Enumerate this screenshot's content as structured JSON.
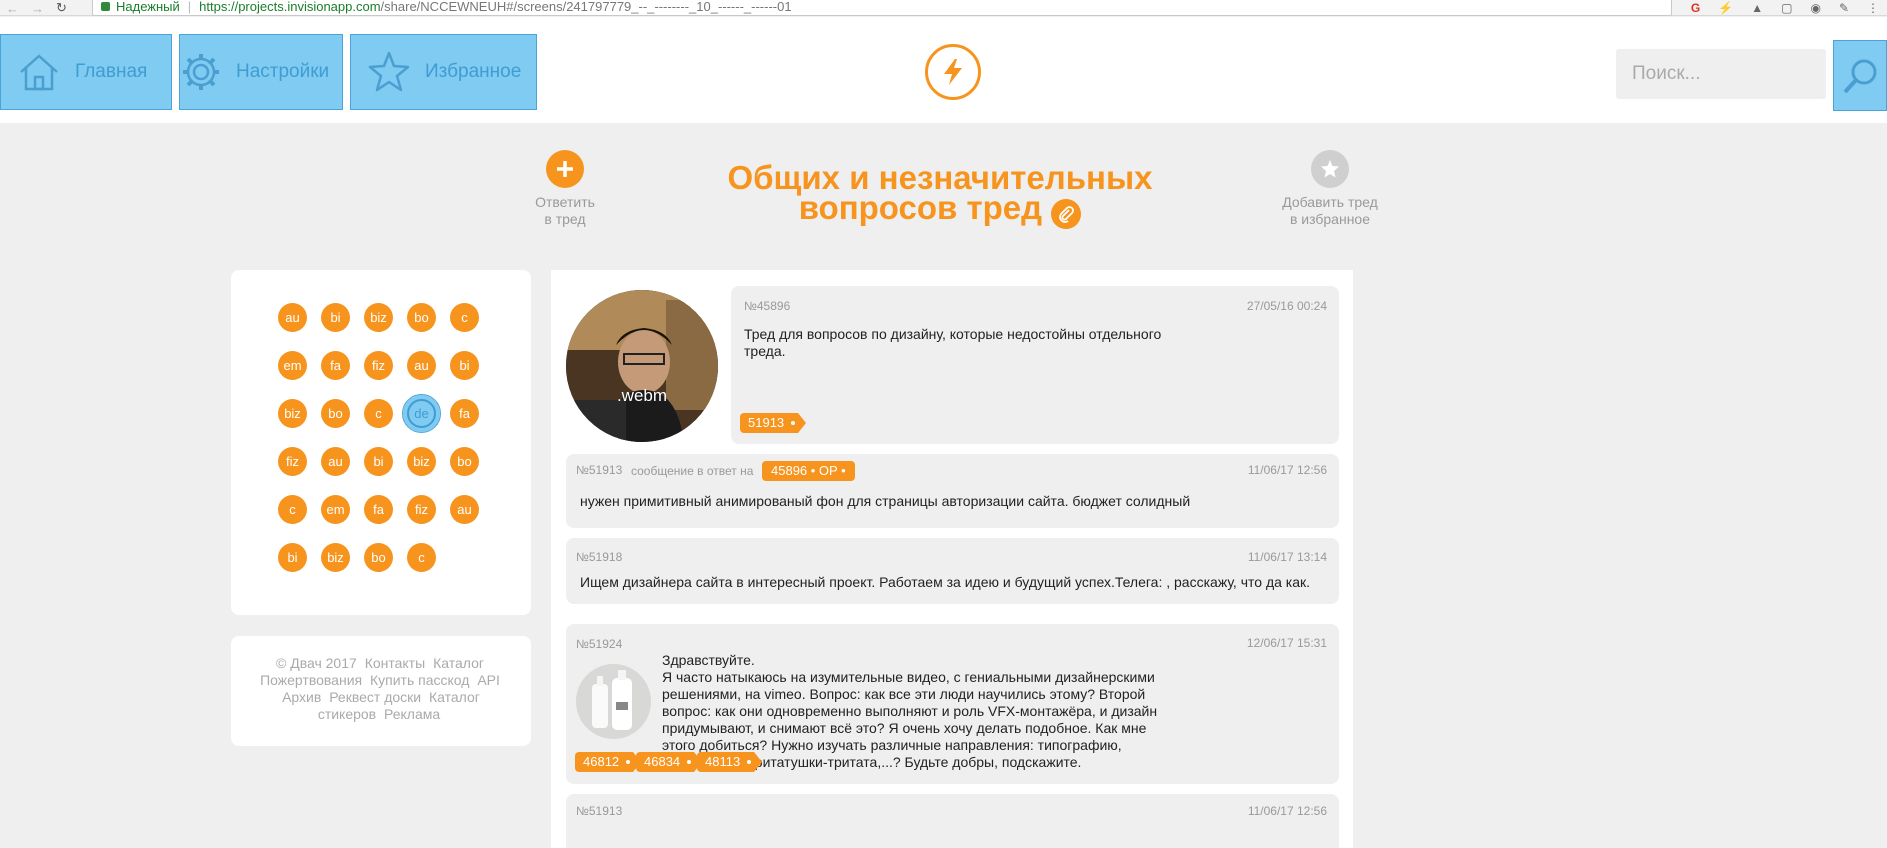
{
  "browser": {
    "secure_label": "Надежный",
    "url_host": "https://projects.invisionapp.com",
    "url_path": "/share/NCCEWNEUH#/screens/241797779_--_--------_10_------_------01"
  },
  "nav": {
    "home": "Главная",
    "settings": "Настройки",
    "favorites": "Избранное"
  },
  "search": {
    "placeholder": "Поиск..."
  },
  "thread": {
    "title_line1": "Общих и незначительных",
    "title_line2": "вопросов тред",
    "reply_line1": "Ответить",
    "reply_line2": "в тред",
    "fav_line1": "Добавить тред",
    "fav_line2": "в избранное"
  },
  "boards": [
    "au",
    "bi",
    "biz",
    "bo",
    "c",
    "em",
    "fa",
    "fiz",
    "au",
    "bi",
    "biz",
    "bo",
    "c",
    "de",
    "fa",
    "fiz",
    "au",
    "bi",
    "biz",
    "bo",
    "c",
    "em",
    "fa",
    "fiz",
    "au",
    "bi",
    "biz",
    "bo",
    "c"
  ],
  "footer": {
    "links": [
      "© Двач 2017",
      "Контакты",
      "Каталог",
      "Пожертвования",
      "Купить пасскод",
      "API",
      "Архив",
      "Реквест доски",
      "Каталог стикеров",
      "Реклама"
    ]
  },
  "posts": {
    "op": {
      "number": "№45896",
      "date": "27/05/16  00:24",
      "avatar_label": ".webm",
      "text": "Тред для вопросов по дизайну, которые недостойны отдельного треда.",
      "reply": "51913"
    },
    "p2": {
      "number": "№51913",
      "reply_label": "сообщение в ответ на",
      "reply_to": "45896 • OP •",
      "date": "11/06/17  12:56",
      "text": "нужен примитивный анимированый фон для страницы авторизации сайта. бюджет солидный"
    },
    "p3": {
      "number": "№51918",
      "date": "11/06/17  13:14",
      "text": "Ищем дизайнера сайта в интересный проект. Работаем за идею и будущий успех.Телега: , расскажу, что да как."
    },
    "p4": {
      "number": "№51924",
      "date": "12/06/17  15:31",
      "text_line1": "Здравствуйте.",
      "text_body": "Я часто натыкаюсь на изумительные видео, с гениальными дизайнерскими решениями, на vimeo. Вопрос: как все эти люди научились этому? Второй вопрос: как они одновременно выполняют и роль VFX-монтажёра, и дизайн придумывают, и снимают всё это? Я очень хочу делать подобное. Как мне этого добиться? Нужно изучать различные направления: типографию, колористику, тритатушки-тритата,...? Будьте добры, подскажите.",
      "replies": [
        "46812",
        "46834",
        "48113"
      ]
    },
    "p5": {
      "number": "№51913",
      "date": "11/06/17  12:56"
    }
  },
  "colors": {
    "accent": "#f7941d",
    "highlight": "#7fcbf2"
  }
}
